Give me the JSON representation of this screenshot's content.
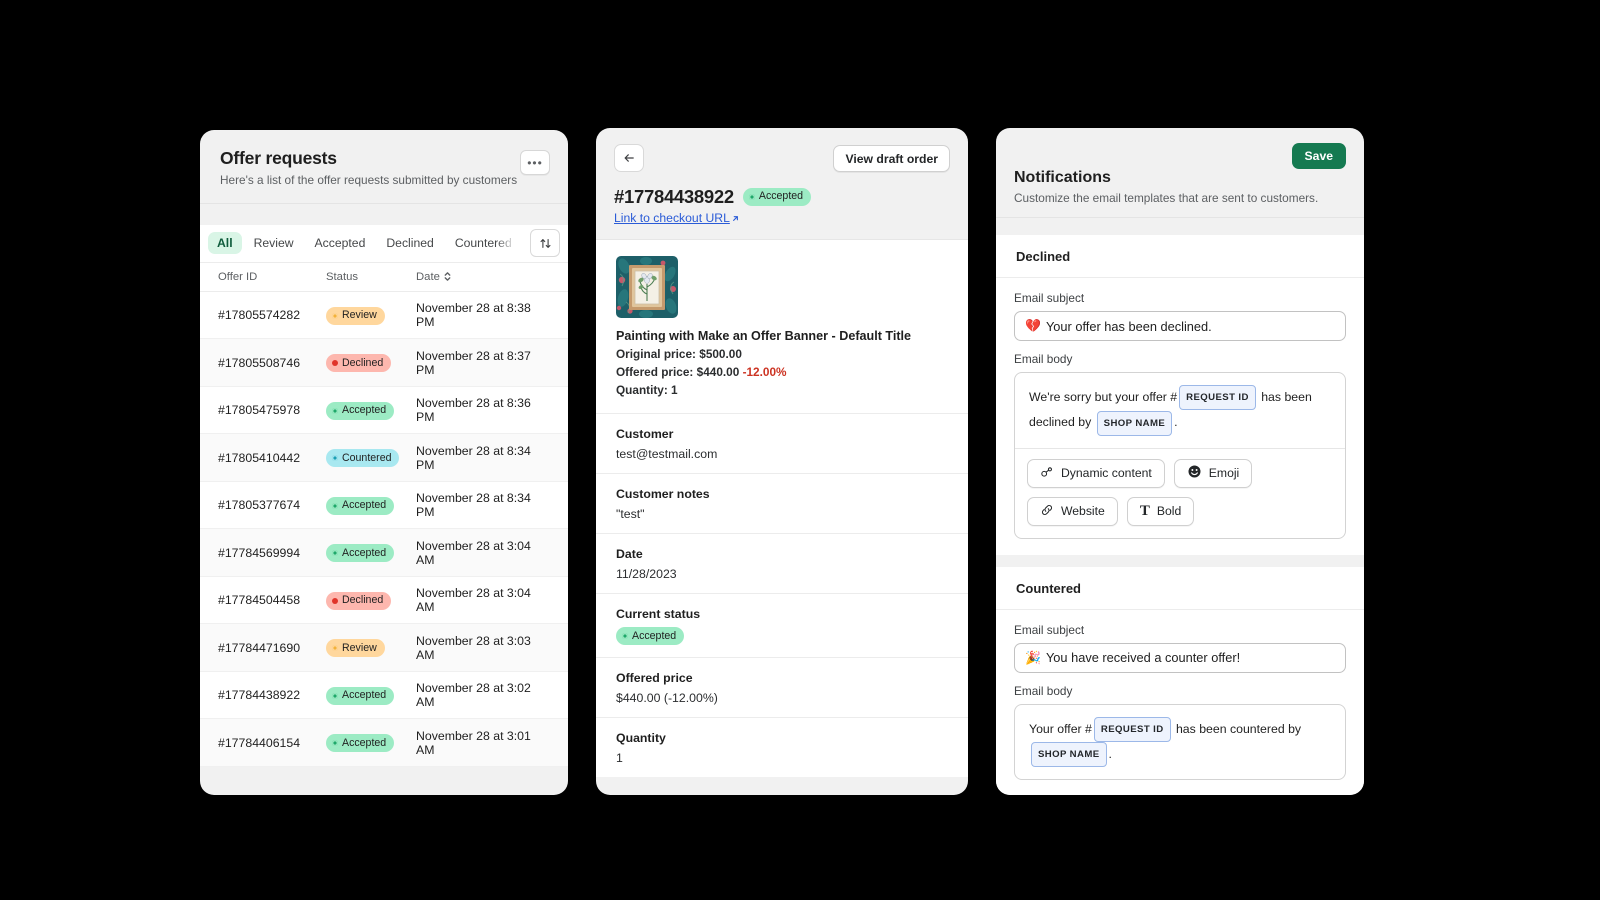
{
  "offers_panel": {
    "title": "Offer requests",
    "subtitle": "Here's a list of the offer requests submitted by customers",
    "more_label": "•••",
    "tabs": [
      {
        "label": "All",
        "active": true
      },
      {
        "label": "Review",
        "active": false
      },
      {
        "label": "Accepted",
        "active": false
      },
      {
        "label": "Declined",
        "active": false
      },
      {
        "label": "Countered",
        "active": false
      }
    ],
    "sort_icon": "sort-ascending-descending-icon",
    "columns": [
      "Offer ID",
      "Status",
      "Date"
    ],
    "date_sort_icon": "chevron-up-down-icon",
    "rows": [
      {
        "id": "#17805574282",
        "status": "Review",
        "status_class": "review",
        "date": "November 28 at 8:38 PM"
      },
      {
        "id": "#17805508746",
        "status": "Declined",
        "status_class": "declined",
        "date": "November 28 at 8:37 PM"
      },
      {
        "id": "#17805475978",
        "status": "Accepted",
        "status_class": "accepted",
        "date": "November 28 at 8:36 PM"
      },
      {
        "id": "#17805410442",
        "status": "Countered",
        "status_class": "countered",
        "date": "November 28 at 8:34 PM"
      },
      {
        "id": "#17805377674",
        "status": "Accepted",
        "status_class": "accepted",
        "date": "November 28 at 8:34 PM"
      },
      {
        "id": "#17784569994",
        "status": "Accepted",
        "status_class": "accepted",
        "date": "November 28 at 3:04 AM"
      },
      {
        "id": "#17784504458",
        "status": "Declined",
        "status_class": "declined",
        "date": "November 28 at 3:04 AM"
      },
      {
        "id": "#17784471690",
        "status": "Review",
        "status_class": "review",
        "date": "November 28 at 3:03 AM"
      },
      {
        "id": "#17784438922",
        "status": "Accepted",
        "status_class": "accepted",
        "date": "November 28 at 3:02 AM"
      },
      {
        "id": "#17784406154",
        "status": "Accepted",
        "status_class": "accepted",
        "date": "November 28 at 3:01 AM"
      }
    ]
  },
  "detail_panel": {
    "back_icon": "arrow-left-icon",
    "draft_order_label": "View draft order",
    "offer_id": "#17784438922",
    "status_badge": "Accepted",
    "checkout_link": "Link to checkout URL",
    "external_link_icon": "external-link-icon",
    "product": {
      "thumbnail_icon": "framed-botanical-painting-thumbnail",
      "title": "Painting with Make an Offer Banner - Default Title",
      "original_price_label": "Original price: $500.00",
      "offered_price_label": "Offered price: $440.00",
      "discount": "-12.00%",
      "quantity_label": "Quantity: 1"
    },
    "fields": [
      {
        "label": "Customer",
        "value": "test@testmail.com"
      },
      {
        "label": "Customer notes",
        "value": "\"test\""
      },
      {
        "label": "Date",
        "value": "11/28/2023"
      },
      {
        "label": "Current status",
        "value": "Accepted",
        "is_badge": true,
        "status_class": "accepted"
      },
      {
        "label": "Offered price",
        "value": "$440.00 (-12.00%)"
      },
      {
        "label": "Quantity",
        "value": "1"
      }
    ]
  },
  "notifications_panel": {
    "save_label": "Save",
    "title": "Notifications",
    "subtitle": "Customize the email templates that are sent to customers.",
    "sections": [
      {
        "title": "Declined",
        "subject_label": "Email subject",
        "subject_emoji": "💔",
        "subject_value": "Your offer has been declined.",
        "body_label": "Email body",
        "body_parts": [
          {
            "type": "text",
            "value": "We're sorry but your offer #"
          },
          {
            "type": "token",
            "value": "REQUEST ID"
          },
          {
            "type": "text",
            "value": " has been declined by "
          },
          {
            "type": "token",
            "value": "SHOP NAME"
          },
          {
            "type": "text",
            "value": "."
          }
        ],
        "toolbar": [
          {
            "label": "Dynamic content",
            "icon": "dynamic-content-icon"
          },
          {
            "label": "Emoji",
            "icon": "emoji-smiley-icon"
          },
          {
            "label": "Website",
            "icon": "link-chain-icon"
          },
          {
            "label": "Bold",
            "icon": "bold-text-icon"
          }
        ]
      },
      {
        "title": "Countered",
        "subject_label": "Email subject",
        "subject_emoji": "🎉",
        "subject_value": "You have received a counter offer!",
        "body_label": "Email body",
        "body_parts": [
          {
            "type": "text",
            "value": "Your offer #"
          },
          {
            "type": "token",
            "value": "REQUEST ID"
          },
          {
            "type": "text",
            "value": " has been countered by "
          },
          {
            "type": "token",
            "value": "SHOP NAME"
          },
          {
            "type": "text",
            "value": "."
          }
        ],
        "toolbar": []
      }
    ]
  },
  "colors": {
    "background": "#000000",
    "panel_header": "#f1f1f1",
    "card": "#ffffff",
    "accent_green": "#157a51",
    "tab_active_bg": "#d9f5e6",
    "link_blue": "#2a5bd7",
    "negative_red": "#cc3322",
    "badge_review": "#ffd79d",
    "badge_declined": "#fdb7ae",
    "badge_accepted": "#9cebc4",
    "badge_countered": "#a8e8f0"
  }
}
